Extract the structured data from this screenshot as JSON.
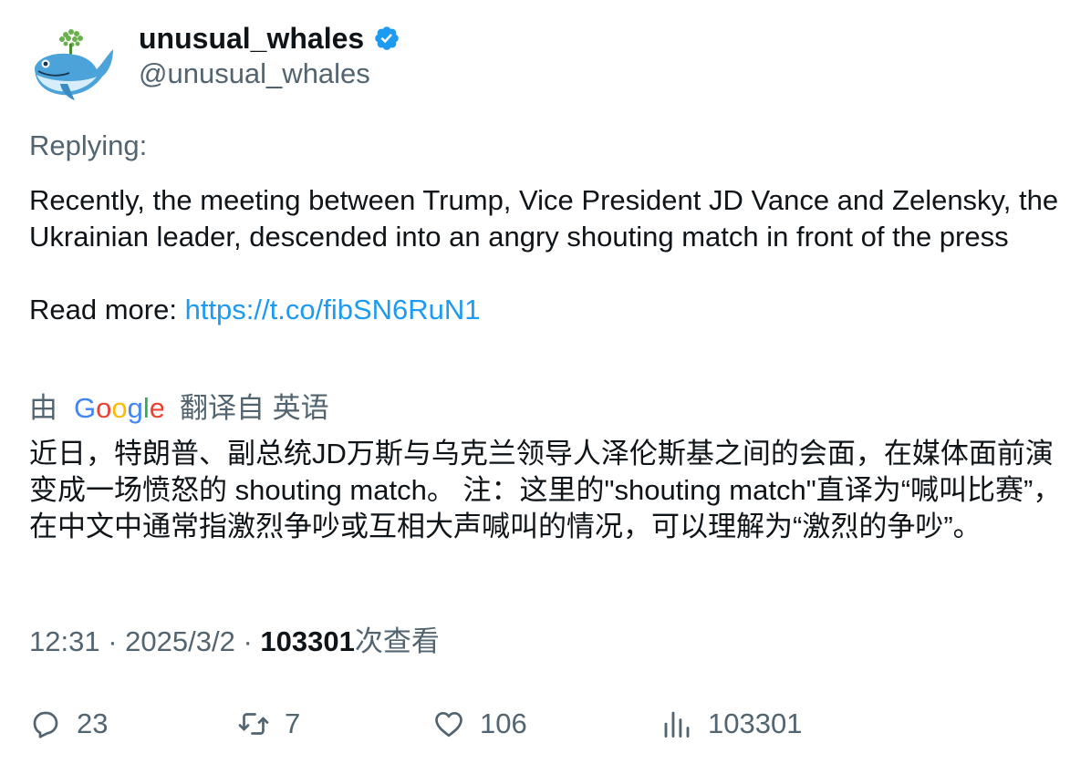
{
  "user": {
    "display_name": "unusual_whales",
    "handle": "@unusual_whales",
    "verified": true,
    "verified_color": "#1d9bf0"
  },
  "tweet": {
    "replying_label": "Replying:",
    "text": "Recently, the meeting between Trump, Vice President JD Vance and Zelensky, the Ukrainian leader, descended into an angry shouting match in front of the press",
    "read_more_label": "Read more:",
    "link": "https://t.co/fibSN6RuN1"
  },
  "translation": {
    "by_label": "由",
    "provider": "Google",
    "from_label": "翻译自 英语",
    "text": "近日，特朗普、副总统JD万斯与乌克兰领导人泽伦斯基之间的会面，在媒体面前演变成一场愤怒的 shouting match。 注：这里的\"shouting match\"直译为“喊叫比赛”，在中文中通常指激烈争吵或互相大声喊叫的情况，可以理解为“激烈的争吵”。"
  },
  "meta": {
    "time": "12:31",
    "date": "2025/3/2",
    "views_count": "103301",
    "views_label": "次查看"
  },
  "actions": {
    "reply_count": "23",
    "retweet_count": "7",
    "like_count": "106",
    "views_count": "103301"
  },
  "colors": {
    "text_primary": "#0f1419",
    "text_secondary": "#536471",
    "link": "#1d9bf0"
  }
}
